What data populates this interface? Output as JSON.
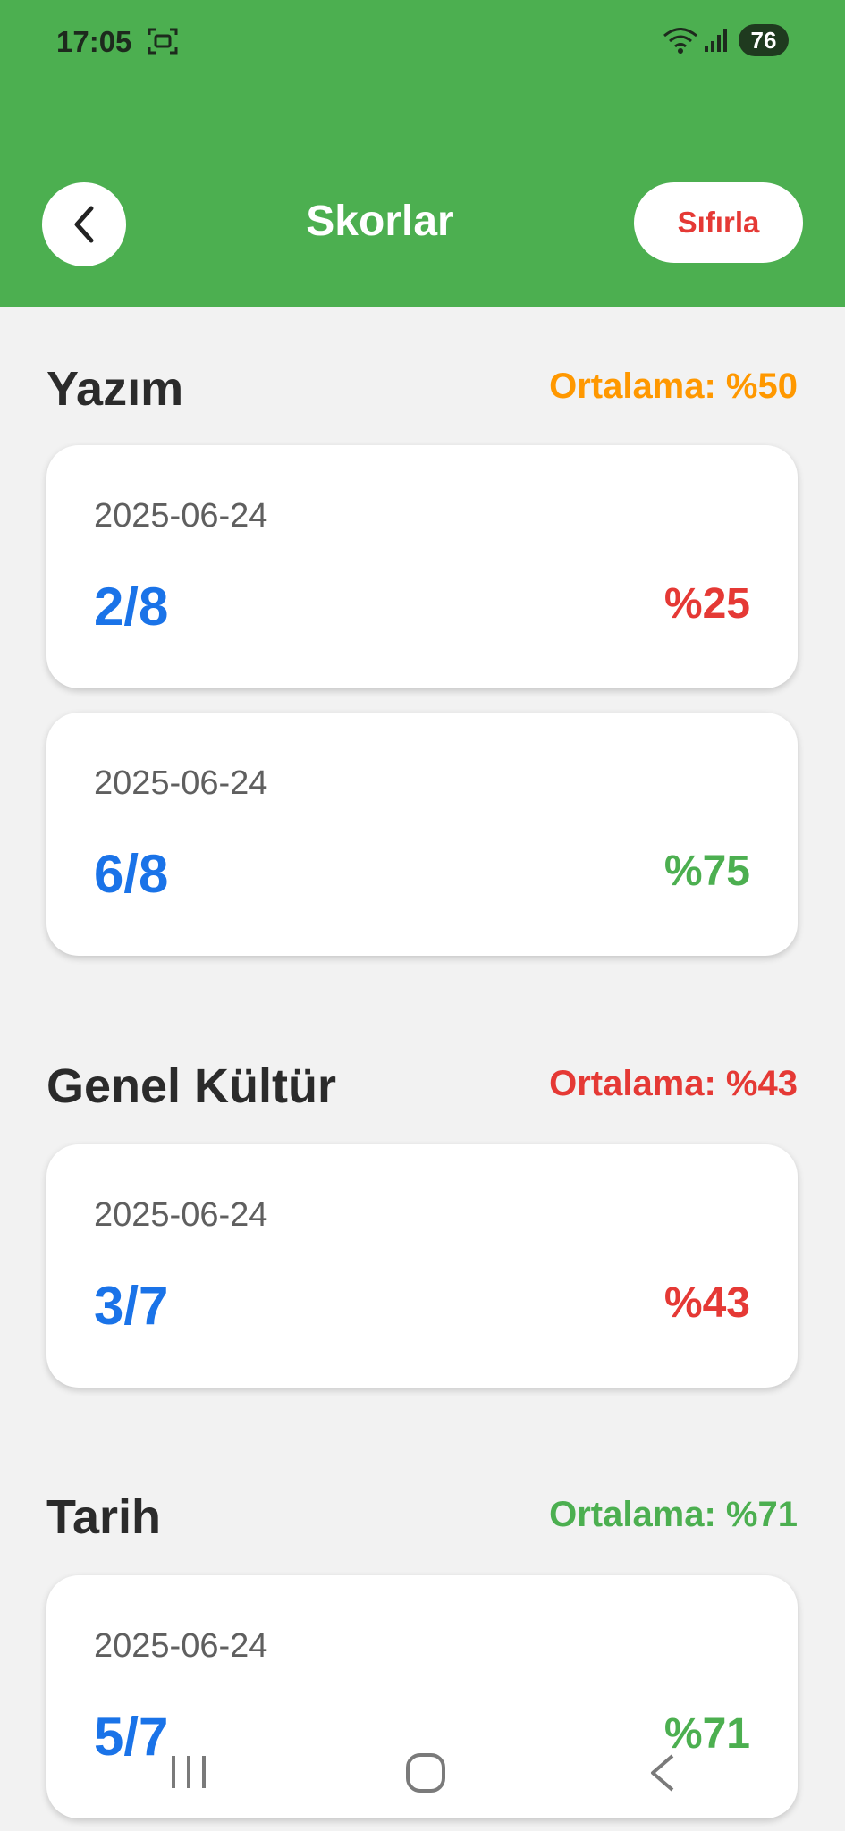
{
  "status_bar": {
    "time": "17:05",
    "battery": "76"
  },
  "header": {
    "title": "Skorlar",
    "reset_label": "Sıfırla"
  },
  "colors": {
    "header": "#4caf50",
    "score": "#1a73e8",
    "red": "#e53935",
    "green": "#4caf50",
    "orange": "#ff9800"
  },
  "sections": [
    {
      "title": "Yazım",
      "average": "Ortalama: %50",
      "average_color": "#ff9800",
      "items": [
        {
          "date": "2025-06-24",
          "score": "2/8",
          "percent": "%25",
          "percent_color": "#e53935"
        },
        {
          "date": "2025-06-24",
          "score": "6/8",
          "percent": "%75",
          "percent_color": "#4caf50"
        }
      ]
    },
    {
      "title": "Genel Kültür",
      "average": "Ortalama: %43",
      "average_color": "#e53935",
      "items": [
        {
          "date": "2025-06-24",
          "score": "3/7",
          "percent": "%43",
          "percent_color": "#e53935"
        }
      ]
    },
    {
      "title": "Tarih",
      "average": "Ortalama: %71",
      "average_color": "#4caf50",
      "items": [
        {
          "date": "2025-06-24",
          "score": "5/7",
          "percent": "%71",
          "percent_color": "#4caf50"
        }
      ]
    }
  ],
  "nav_bar": {
    "recent_icon": "recent-apps-icon",
    "home_icon": "home-icon",
    "back_icon": "back-icon"
  }
}
